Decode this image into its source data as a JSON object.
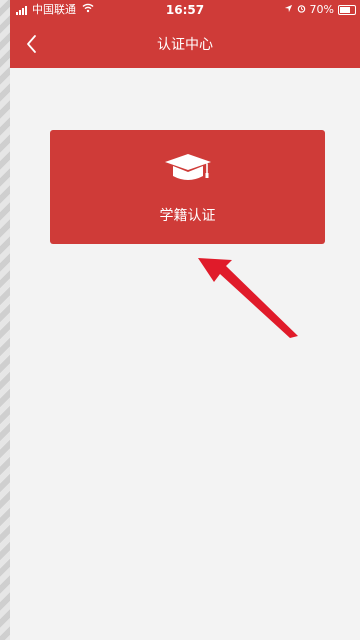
{
  "status_bar": {
    "carrier": "中国联通",
    "time": "16:57",
    "battery": "70%",
    "icons": [
      "signal-icon",
      "wifi-icon",
      "location-icon",
      "alarm-icon",
      "battery-icon"
    ]
  },
  "header": {
    "title": "认证中心",
    "back_icon": "chevron-left-icon"
  },
  "cards": [
    {
      "label": "学籍认证",
      "icon": "graduation-cap-icon"
    }
  ],
  "colors": {
    "header": "#cf3b38",
    "card": "#cf3b38",
    "background": "#f3f3f3",
    "annotation_arrow": "#e01b2a"
  }
}
